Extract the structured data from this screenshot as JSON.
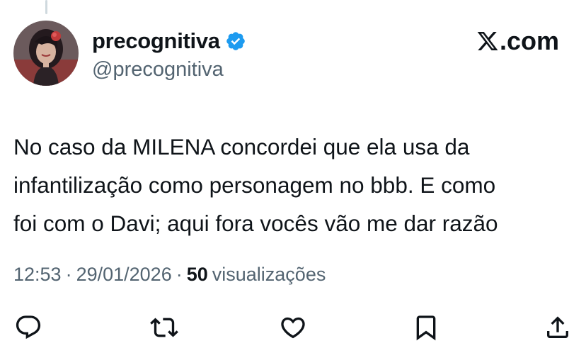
{
  "profile": {
    "display_name": "precognitiva",
    "handle": "@precognitiva",
    "verified": true
  },
  "brand": {
    "label": ".com"
  },
  "tweet": {
    "lines": [
      "No caso da MILENA concordei que ela usa da",
      "infantilização como personagem no bbb. E como",
      "foi com o Davi; aqui fora vocês vão me dar razão"
    ]
  },
  "meta": {
    "time": "12:53",
    "separator": "·",
    "date": "29/01/2026",
    "views_count": "50",
    "views_label": "visualizações"
  },
  "actions": [
    {
      "name": "reply-icon"
    },
    {
      "name": "retweet-icon"
    },
    {
      "name": "like-icon"
    },
    {
      "name": "bookmark-icon"
    },
    {
      "name": "share-icon"
    }
  ],
  "colors": {
    "text": "#0f1419",
    "secondary": "#536471",
    "verified": "#1d9bf0"
  }
}
